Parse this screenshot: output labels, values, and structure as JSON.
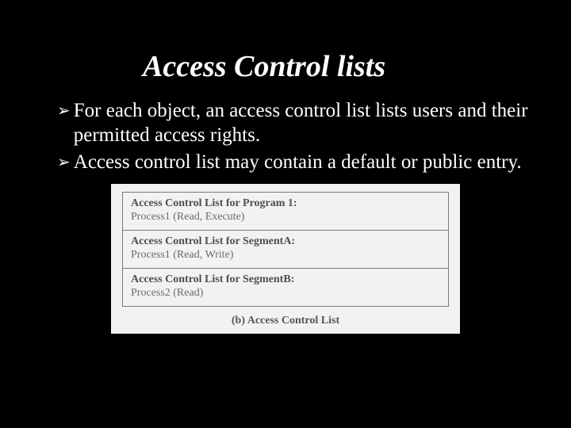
{
  "title": "Access Control lists",
  "bullets": [
    "For each object, an access control list lists users and their permitted access rights.",
    "Access control list may contain a default or public entry."
  ],
  "figure": {
    "rows": [
      {
        "head": "Access Control List for Program 1:",
        "body": "Process1 (Read, Execute)"
      },
      {
        "head": "Access Control List for SegmentA:",
        "body": "Process1 (Read, Write)"
      },
      {
        "head": "Access Control List for SegmentB:",
        "body": "Process2 (Read)"
      }
    ],
    "caption": "(b) Access Control List"
  }
}
